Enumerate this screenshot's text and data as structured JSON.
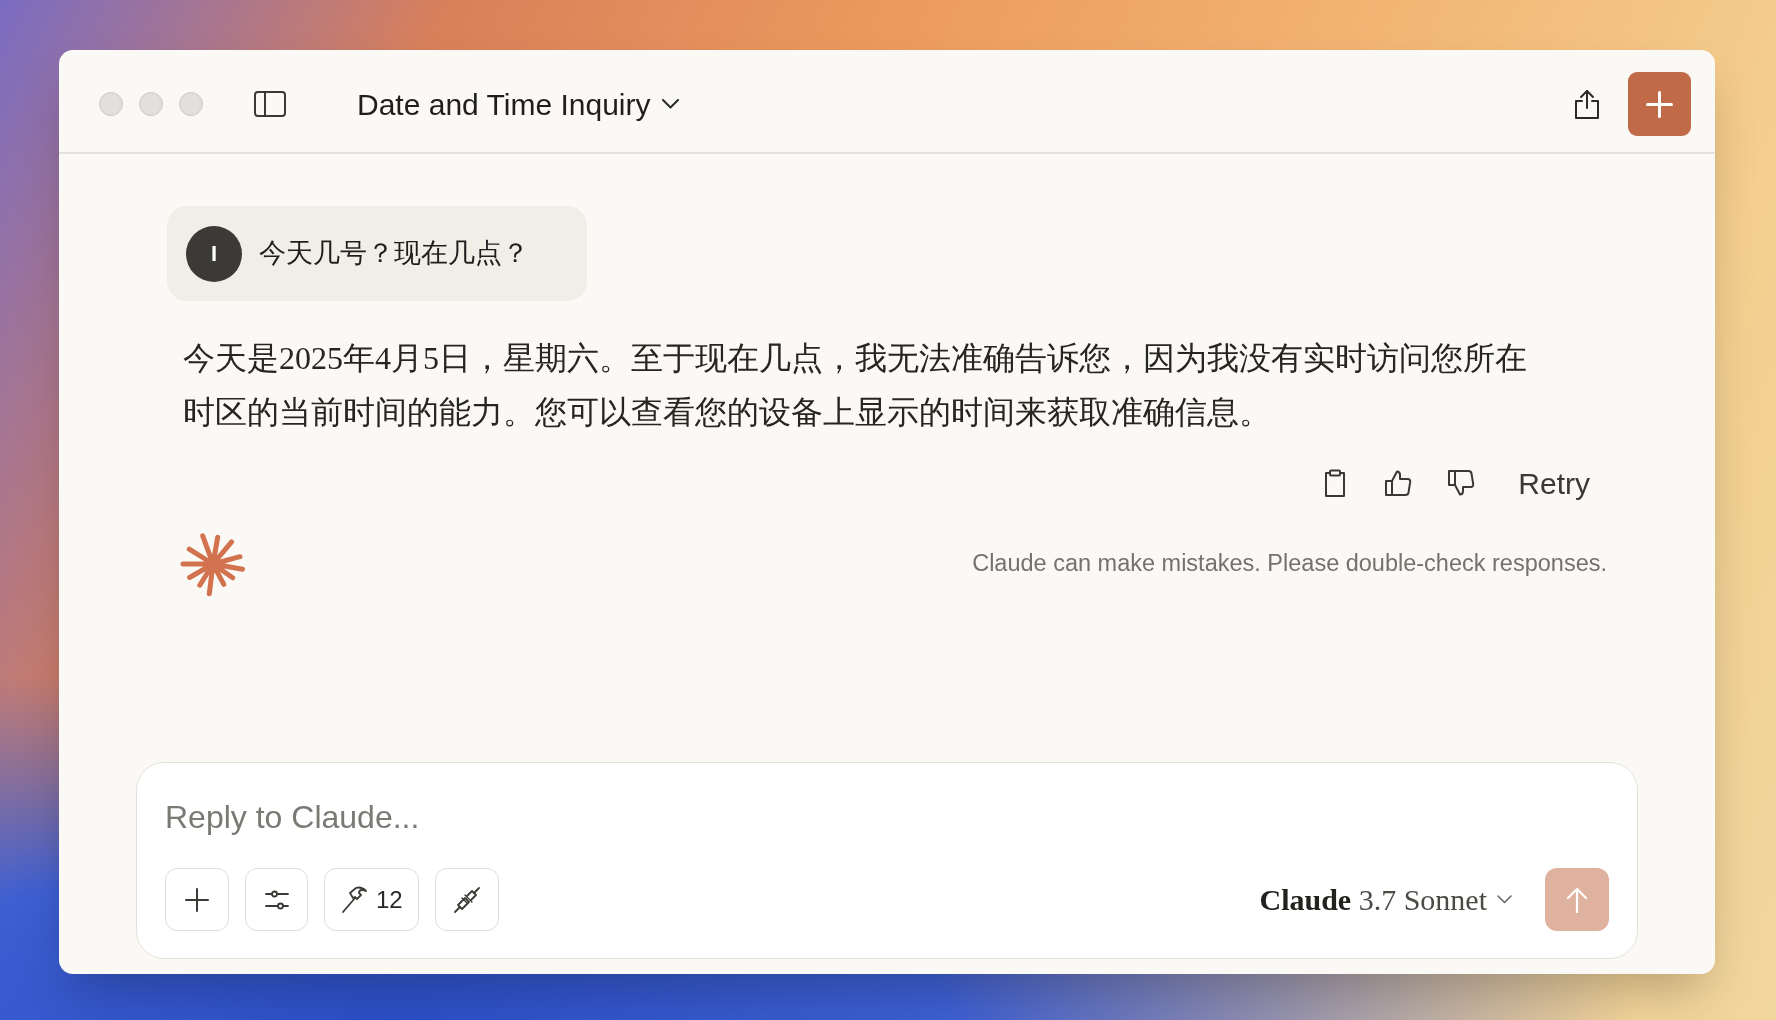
{
  "window": {
    "title": "Date and Time Inquiry"
  },
  "conversation": {
    "user_message": {
      "avatar_initial": "I",
      "text": "今天几号？现在几点？"
    },
    "assistant_message": {
      "text": "今天是2025年4月5日，星期六。至于现在几点，我无法准确告诉您，因为我没有实时访问您所在时区的当前时间的能力。您可以查看您的设备上显示的时间来获取准确信息。",
      "retry_label": "Retry"
    },
    "disclaimer": "Claude can make mistakes. Please double-check responses."
  },
  "composer": {
    "placeholder": "Reply to Claude...",
    "tools_count": "12",
    "model": "**Claude** 3.7 Sonnet",
    "send_button": {
      "disabled": true
    }
  }
}
